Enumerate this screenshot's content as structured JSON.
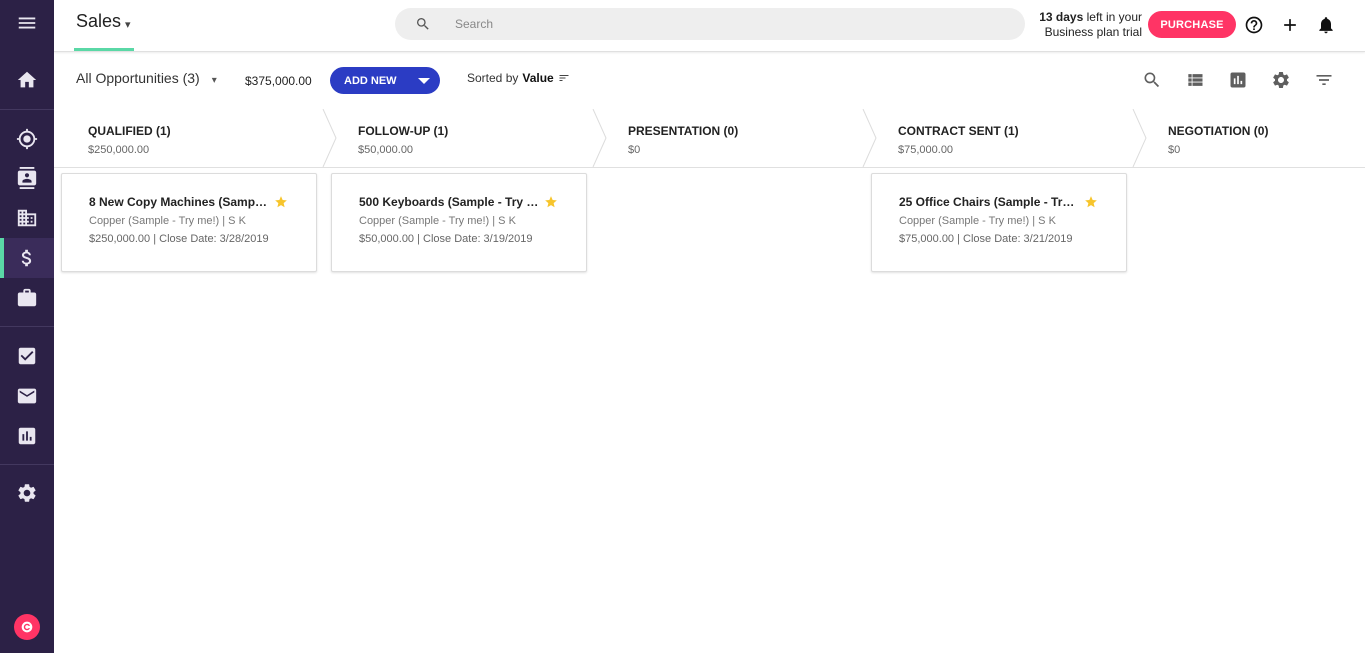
{
  "header": {
    "title": "Sales",
    "search_placeholder": "Search",
    "trial_days": "13 days",
    "trial_text_1": " left in your",
    "trial_text_2": "Business plan trial",
    "purchase_label": "PURCHASE"
  },
  "toolbar": {
    "view_label": "All Opportunities (3)",
    "total_value": "$375,000.00",
    "add_new_label": "ADD NEW",
    "sorted_prefix": "Sorted by",
    "sorted_value": "Value"
  },
  "stages": [
    {
      "name": "QUALIFIED (1)",
      "amount": "$250,000.00"
    },
    {
      "name": "FOLLOW-UP (1)",
      "amount": "$50,000.00"
    },
    {
      "name": "PRESENTATION (0)",
      "amount": "$0"
    },
    {
      "name": "CONTRACT SENT (1)",
      "amount": "$75,000.00"
    },
    {
      "name": "NEGOTIATION (0)",
      "amount": "$0"
    }
  ],
  "cards": [
    {
      "title": "8 New Copy Machines (Sample ...",
      "company": "Copper (Sample - Try me!) | S K",
      "meta": "$250,000.00 | Close Date: 3/28/2019",
      "starred": true
    },
    {
      "title": "500 Keyboards (Sample - Try m...",
      "company": "Copper (Sample - Try me!) | S K",
      "meta": "$50,000.00 | Close Date: 3/19/2019",
      "starred": true
    },
    {
      "title": "25 Office Chairs (Sample - Try ...",
      "company": "Copper (Sample - Try me!) | S K",
      "meta": "$75,000.00 | Close Date: 3/21/2019",
      "starred": true
    }
  ],
  "sidebar": {
    "items": [
      "menu-icon",
      "home-icon",
      "leads-icon",
      "people-icon",
      "companies-icon",
      "opportunities-icon",
      "projects-icon",
      "tasks-icon",
      "email-icon",
      "reports-icon",
      "settings-icon"
    ],
    "active": "opportunities-icon"
  },
  "colors": {
    "sidebar_bg": "#2c2146",
    "accent_green": "#5ad8a6",
    "purchase_pink": "#ff3465",
    "add_new_blue": "#2b3cc4",
    "star_yellow": "#f7c52c"
  }
}
